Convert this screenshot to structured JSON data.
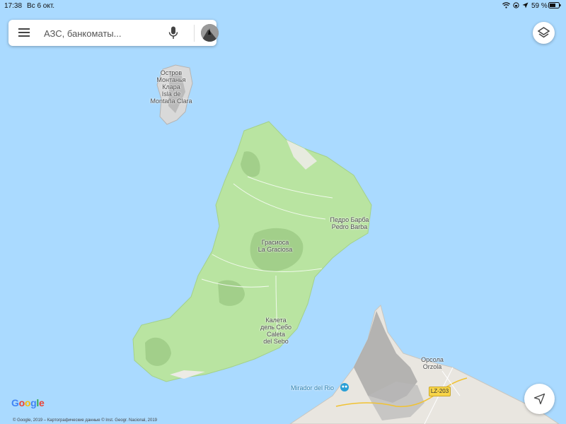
{
  "status_bar": {
    "time": "17:38",
    "date": "Вс 6 окт.",
    "battery": "59 %"
  },
  "search": {
    "placeholder": "АЗС, банкоматы..."
  },
  "map": {
    "islands": {
      "montana_clara": [
        "Остров",
        "Монтанья",
        "Клара",
        "Isla de",
        "Montaña Clara"
      ],
      "la_graciosa": [
        "Грасиоса",
        "La Graciosa"
      ]
    },
    "places": {
      "pedro_barba": [
        "Педро Барба",
        "Pedro Barba"
      ],
      "caleta_del_sebo": [
        "Калета",
        "дель Себо",
        "Caleta",
        "del Sebo"
      ],
      "orzola": [
        "Орсола",
        "Orzola"
      ]
    },
    "poi": {
      "label": "Mirador del Rio"
    },
    "road": {
      "label": "LZ-203"
    },
    "colors": {
      "water": "#aadaff",
      "land_green": "#b9e4a1",
      "land_gray": "#e9e6e0",
      "accent": "#2a9fd6"
    }
  },
  "branding": {
    "logo": "Google",
    "copyright": "© Google, 2019 – Картографические данные © Inst. Geogr. Nacional, 2019"
  },
  "icons": [
    "wifi-icon",
    "menu-icon",
    "mic-icon",
    "layers-icon",
    "location-arrow-icon",
    "binoculars-icon",
    "battery-icon"
  ]
}
